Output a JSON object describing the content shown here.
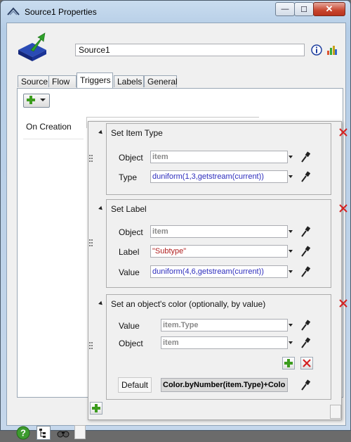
{
  "window": {
    "title": "Source1  Properties",
    "close_label": "✕",
    "minimize_label": "—",
    "maximize_label": "☐"
  },
  "object": {
    "name": "Source1"
  },
  "tabs": [
    {
      "label": "Source"
    },
    {
      "label": "Flow"
    },
    {
      "label": "Triggers"
    },
    {
      "label": "Labels"
    },
    {
      "label": "General"
    }
  ],
  "active_tab": "Triggers",
  "triggers": {
    "items": [
      {
        "label": "On Creation"
      }
    ]
  },
  "blocks": [
    {
      "title": "Set Item Type",
      "rows": [
        {
          "label": "Object",
          "value": "item"
        },
        {
          "label": "Type",
          "value": "duniform(1,3,getstream(current))"
        }
      ]
    },
    {
      "title": "Set Label",
      "rows": [
        {
          "label": "Object",
          "value": "item"
        },
        {
          "label": "Label",
          "value": "\"Subtype\""
        },
        {
          "label": "Value",
          "value": "duniform(4,6,getstream(current))"
        }
      ]
    },
    {
      "title": "Set an object's color (optionally, by value)",
      "rows": [
        {
          "label": "Value",
          "value": "item.Type"
        },
        {
          "label": "Object",
          "value": "item"
        }
      ],
      "default_label": "Default",
      "default_value": "Color.byNumber(item.Type)+Colo"
    }
  ],
  "icons": {
    "info": "info-icon",
    "properties": "properties-icon",
    "help": "help-icon",
    "tree": "tree-icon",
    "find": "find-icon"
  },
  "colors": {
    "accent_green": "#3c9c1e",
    "remove_red": "#d42020",
    "code_keyword": "#2d2dbd",
    "code_string": "#b01f1f"
  }
}
